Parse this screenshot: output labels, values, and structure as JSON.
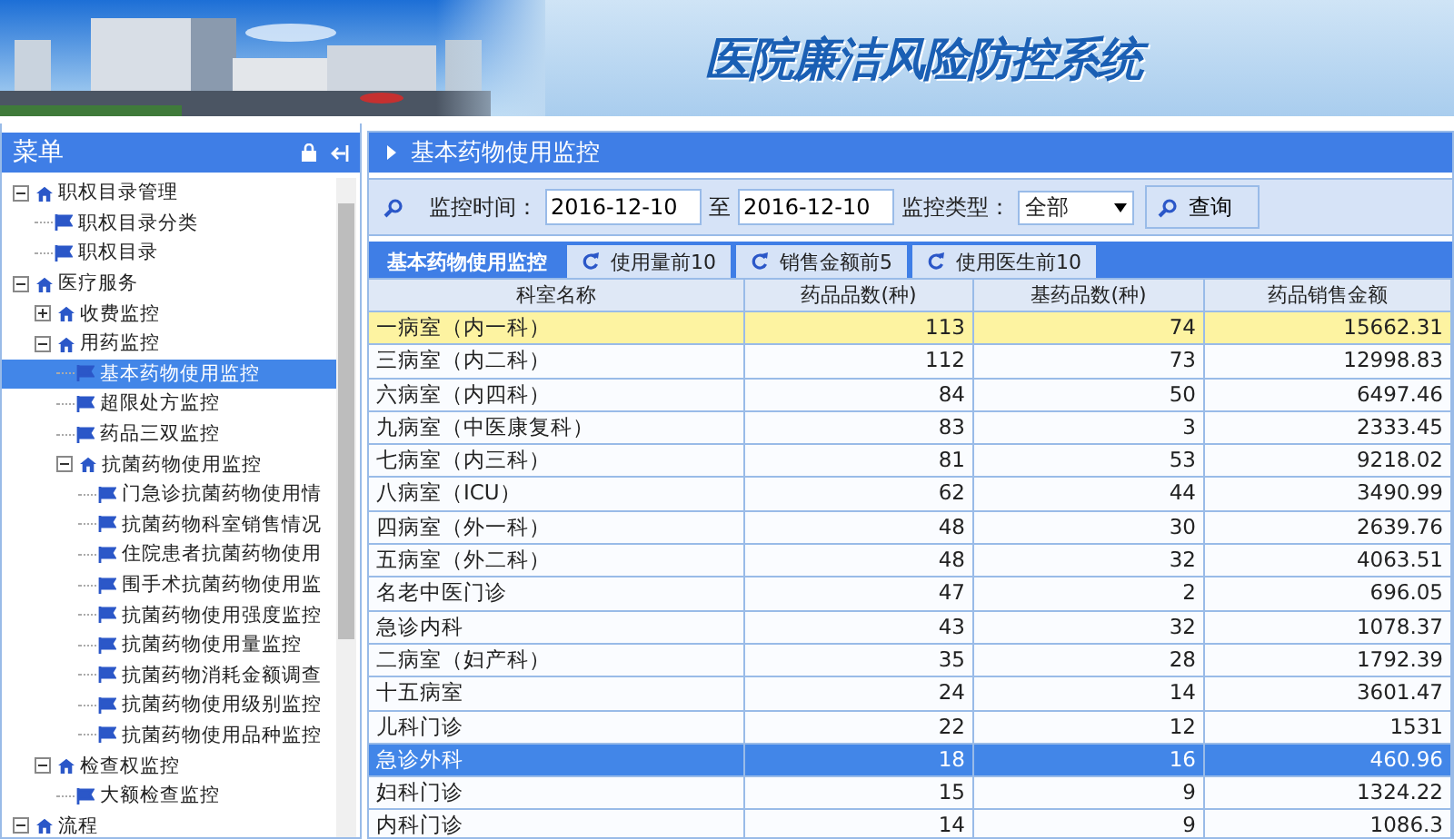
{
  "header": {
    "title": "医院廉洁风险防控系统"
  },
  "sidebar": {
    "title": "菜单",
    "items": [
      {
        "label": "职权目录管理",
        "expanded": true,
        "selected": false,
        "children": [
          {
            "label": "职权目录分类",
            "selected": false
          },
          {
            "label": "职权目录",
            "selected": false
          }
        ]
      },
      {
        "label": "医疗服务",
        "expanded": true,
        "selected": false,
        "children": [
          {
            "label": "收费监控",
            "expanded": false,
            "selected": false
          },
          {
            "label": "用药监控",
            "expanded": true,
            "selected": false,
            "children": [
              {
                "label": "基本药物使用监控",
                "selected": true
              },
              {
                "label": "超限处方监控",
                "selected": false
              },
              {
                "label": "药品三双监控",
                "selected": false
              },
              {
                "label": "抗菌药物使用监控",
                "expanded": true,
                "selected": false,
                "children": [
                  {
                    "label": "门急诊抗菌药物使用情",
                    "selected": false
                  },
                  {
                    "label": "抗菌药物科室销售情况",
                    "selected": false
                  },
                  {
                    "label": "住院患者抗菌药物使用",
                    "selected": false
                  },
                  {
                    "label": "围手术抗菌药物使用监",
                    "selected": false
                  },
                  {
                    "label": "抗菌药物使用强度监控",
                    "selected": false
                  },
                  {
                    "label": "抗菌药物使用量监控",
                    "selected": false
                  },
                  {
                    "label": "抗菌药物消耗金额调查",
                    "selected": false
                  },
                  {
                    "label": "抗菌药物使用级别监控",
                    "selected": false
                  },
                  {
                    "label": "抗菌药物使用品种监控",
                    "selected": false
                  }
                ]
              }
            ]
          },
          {
            "label": "检查权监控",
            "expanded": true,
            "selected": false,
            "children": [
              {
                "label": "大额检查监控",
                "selected": false
              }
            ]
          }
        ]
      },
      {
        "label": "流程",
        "expanded": true,
        "selected": false
      }
    ]
  },
  "panel": {
    "title": "基本药物使用监控"
  },
  "filter": {
    "time_label": "监控时间：",
    "date_from": "2016-12-10",
    "to_label": "至",
    "date_to": "2016-12-10",
    "type_label": "监控类型：",
    "type_value": "全部",
    "query_button": "查询"
  },
  "tabs": [
    {
      "label": "基本药物使用监控",
      "selected": true
    },
    {
      "label": "使用量前10",
      "selected": false
    },
    {
      "label": "销售金额前5",
      "selected": false
    },
    {
      "label": "使用医生前10",
      "selected": false
    }
  ],
  "table": {
    "columns": [
      "科室名称",
      "药品品数(种)",
      "基药品数(种)",
      "药品销售金额"
    ],
    "rows": [
      {
        "cells": [
          "一病室（内一科）",
          "113",
          "74",
          "15662.31"
        ],
        "highlighted": true,
        "selected": false
      },
      {
        "cells": [
          "三病室（内二科）",
          "112",
          "73",
          "12998.83"
        ],
        "highlighted": false,
        "selected": false
      },
      {
        "cells": [
          "六病室（内四科）",
          "84",
          "50",
          "6497.46"
        ],
        "highlighted": false,
        "selected": false
      },
      {
        "cells": [
          "九病室（中医康复科）",
          "83",
          "3",
          "2333.45"
        ],
        "highlighted": false,
        "selected": false
      },
      {
        "cells": [
          "七病室（内三科）",
          "81",
          "53",
          "9218.02"
        ],
        "highlighted": false,
        "selected": false
      },
      {
        "cells": [
          "八病室（ICU）",
          "62",
          "44",
          "3490.99"
        ],
        "highlighted": false,
        "selected": false
      },
      {
        "cells": [
          "四病室（外一科）",
          "48",
          "30",
          "2639.76"
        ],
        "highlighted": false,
        "selected": false
      },
      {
        "cells": [
          "五病室（外二科）",
          "48",
          "32",
          "4063.51"
        ],
        "highlighted": false,
        "selected": false
      },
      {
        "cells": [
          "名老中医门诊",
          "47",
          "2",
          "696.05"
        ],
        "highlighted": false,
        "selected": false
      },
      {
        "cells": [
          "急诊内科",
          "43",
          "32",
          "1078.37"
        ],
        "highlighted": false,
        "selected": false
      },
      {
        "cells": [
          "二病室（妇产科）",
          "35",
          "28",
          "1792.39"
        ],
        "highlighted": false,
        "selected": false
      },
      {
        "cells": [
          "十五病室",
          "24",
          "14",
          "3601.47"
        ],
        "highlighted": false,
        "selected": false
      },
      {
        "cells": [
          "儿科门诊",
          "22",
          "12",
          "1531"
        ],
        "highlighted": false,
        "selected": false
      },
      {
        "cells": [
          "急诊外科",
          "18",
          "16",
          "460.96"
        ],
        "highlighted": false,
        "selected": true
      },
      {
        "cells": [
          "妇科门诊",
          "15",
          "9",
          "1324.22"
        ],
        "highlighted": false,
        "selected": false
      },
      {
        "cells": [
          "内科门诊",
          "14",
          "9",
          "1086.3"
        ],
        "highlighted": false,
        "selected": false
      }
    ]
  }
}
